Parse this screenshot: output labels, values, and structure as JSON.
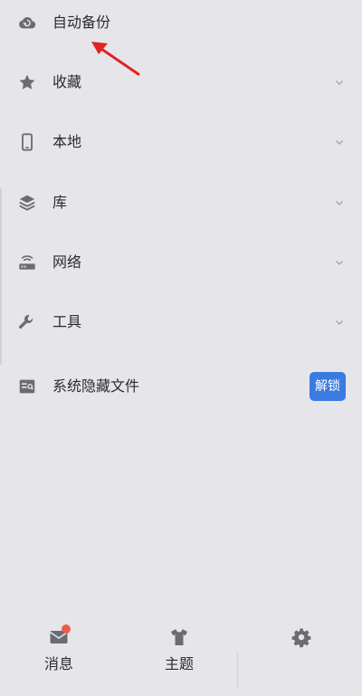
{
  "menu": {
    "items": [
      {
        "icon": "cloud-backup-icon",
        "label": "自动备份",
        "has_chevron": false
      },
      {
        "icon": "star-icon",
        "label": "收藏",
        "has_chevron": true
      },
      {
        "icon": "phone-icon",
        "label": "本地",
        "has_chevron": true
      },
      {
        "icon": "layers-icon",
        "label": "库",
        "has_chevron": true
      },
      {
        "icon": "router-icon",
        "label": "网络",
        "has_chevron": true
      },
      {
        "icon": "wrench-icon",
        "label": "工具",
        "has_chevron": true
      },
      {
        "icon": "hidden-file-icon",
        "label": "系统隐藏文件",
        "has_chevron": false,
        "button": "解锁"
      }
    ]
  },
  "bottom_nav": {
    "tabs": [
      {
        "icon": "mail-icon",
        "label": "消息",
        "badge": true
      },
      {
        "icon": "tshirt-icon",
        "label": "主题"
      },
      {
        "icon": "gear-icon",
        "label": ""
      }
    ]
  },
  "colors": {
    "background": "#e6e6ea",
    "icon": "#6b6b73",
    "accent_button": "#3a7be0",
    "badge": "#f05b4e",
    "annotation_arrow": "#e02424"
  }
}
